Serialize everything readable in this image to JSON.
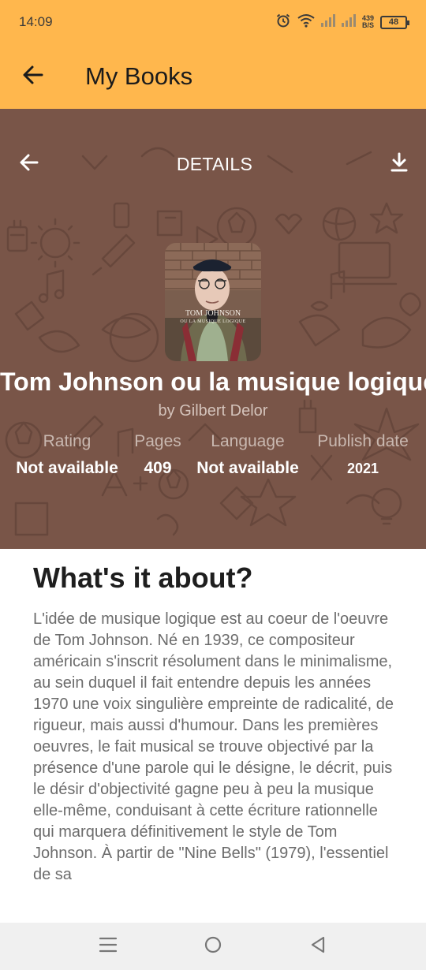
{
  "status_bar": {
    "time": "14:09",
    "net_speed_value": "439",
    "net_speed_unit": "B/S",
    "battery": "48"
  },
  "app_bar": {
    "title": "My Books"
  },
  "details": {
    "header_title": "DETAILS",
    "cover": {
      "caption_title": "TOM JOHNSON",
      "caption_subtitle": "OU LA MUSIQUE LOGIQUE"
    },
    "book_title": "Tom Johnson ou la musique logique",
    "author": "by Gilbert Delor",
    "stats": [
      {
        "label": "Rating",
        "value": "Not available"
      },
      {
        "label": "Pages",
        "value": "409"
      },
      {
        "label": "Language",
        "value": "Not available"
      },
      {
        "label": "Publish date",
        "value": "2021"
      }
    ]
  },
  "about": {
    "heading": "What's it about?",
    "text": "L'idée de musique logique est au coeur de l'oeuvre de Tom Johnson. Né en 1939, ce compositeur américain s'inscrit résolument dans le minimalisme, au sein duquel il fait entendre depuis les années 1970 une voix singulière empreinte de radicalité, de rigueur, mais aussi d'humour. Dans les premières oeuvres, le fait musical se trouve objectivé par la présence d'une parole qui le désigne, le décrit, puis le désir d'objectivité gagne peu à peu la musique elle-même, conduisant à cette écriture rationnelle qui marquera définitivement le style de Tom Johnson. À partir de \"Nine Bells\" (1979), l'essentiel de sa"
  },
  "colors": {
    "accent": "#FFB74D",
    "hero_background": "#795548"
  },
  "icons": {
    "app_back": "arrow-left-icon",
    "details_back": "arrow-left-icon",
    "download": "download-icon",
    "nav_recents": "menu-icon",
    "nav_home": "circle-home-icon",
    "nav_back": "triangle-back-icon"
  }
}
